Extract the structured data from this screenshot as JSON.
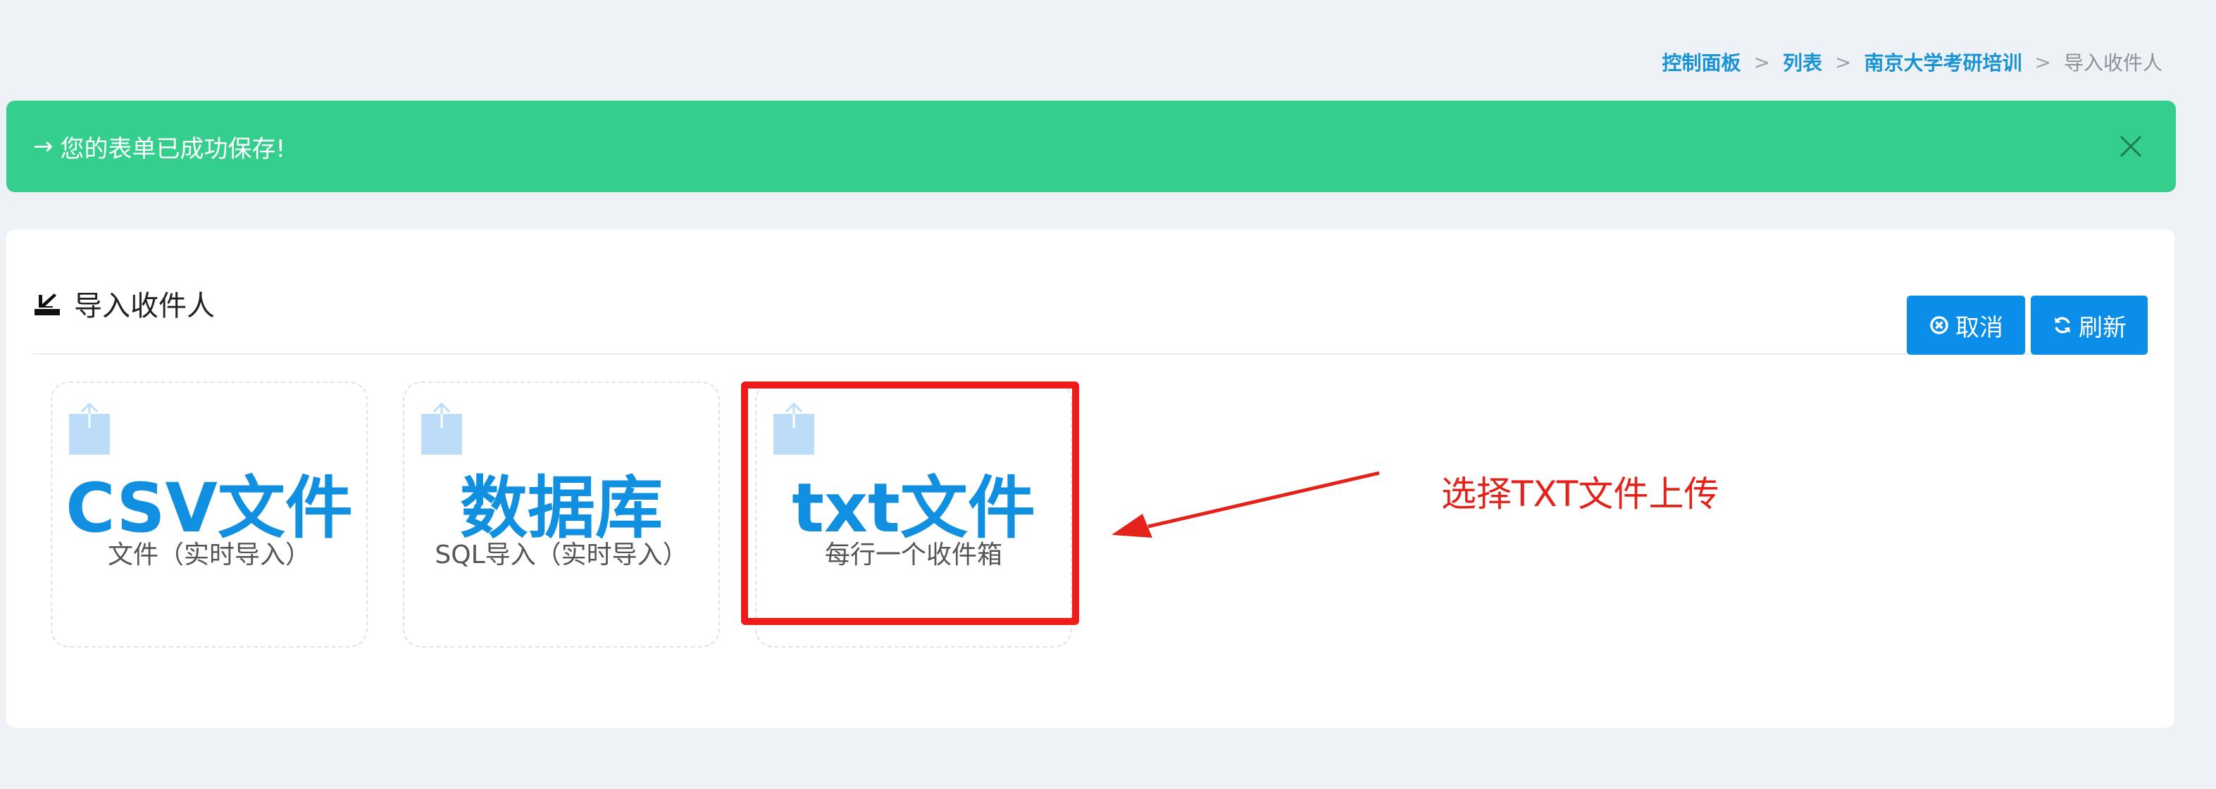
{
  "breadcrumb": {
    "items": [
      "控制面板",
      "列表",
      "南京大学考研培训"
    ],
    "current": "导入收件人",
    "separator": ">"
  },
  "alert": {
    "arrow": "→",
    "message": "您的表单已成功保存!",
    "close_icon": "close-icon",
    "color": "#34cf8c"
  },
  "panel": {
    "title": "导入收件人",
    "title_icon": "import-icon",
    "buttons": {
      "cancel": "取消",
      "refresh": "刷新"
    }
  },
  "cards": [
    {
      "title": "CSV文件",
      "subtitle": "文件（实时导入）",
      "icon": "upload-icon"
    },
    {
      "title": "数据库",
      "subtitle": "SQL导入（实时导入）",
      "icon": "upload-icon"
    },
    {
      "title": "txt文件",
      "subtitle": "每行一个收件箱",
      "icon": "upload-icon"
    }
  ],
  "annotation": {
    "text": "选择TXT文件上传",
    "color": "#e32219"
  },
  "colors": {
    "accent": "#0a8ee8",
    "card_title": "#118fe0"
  }
}
